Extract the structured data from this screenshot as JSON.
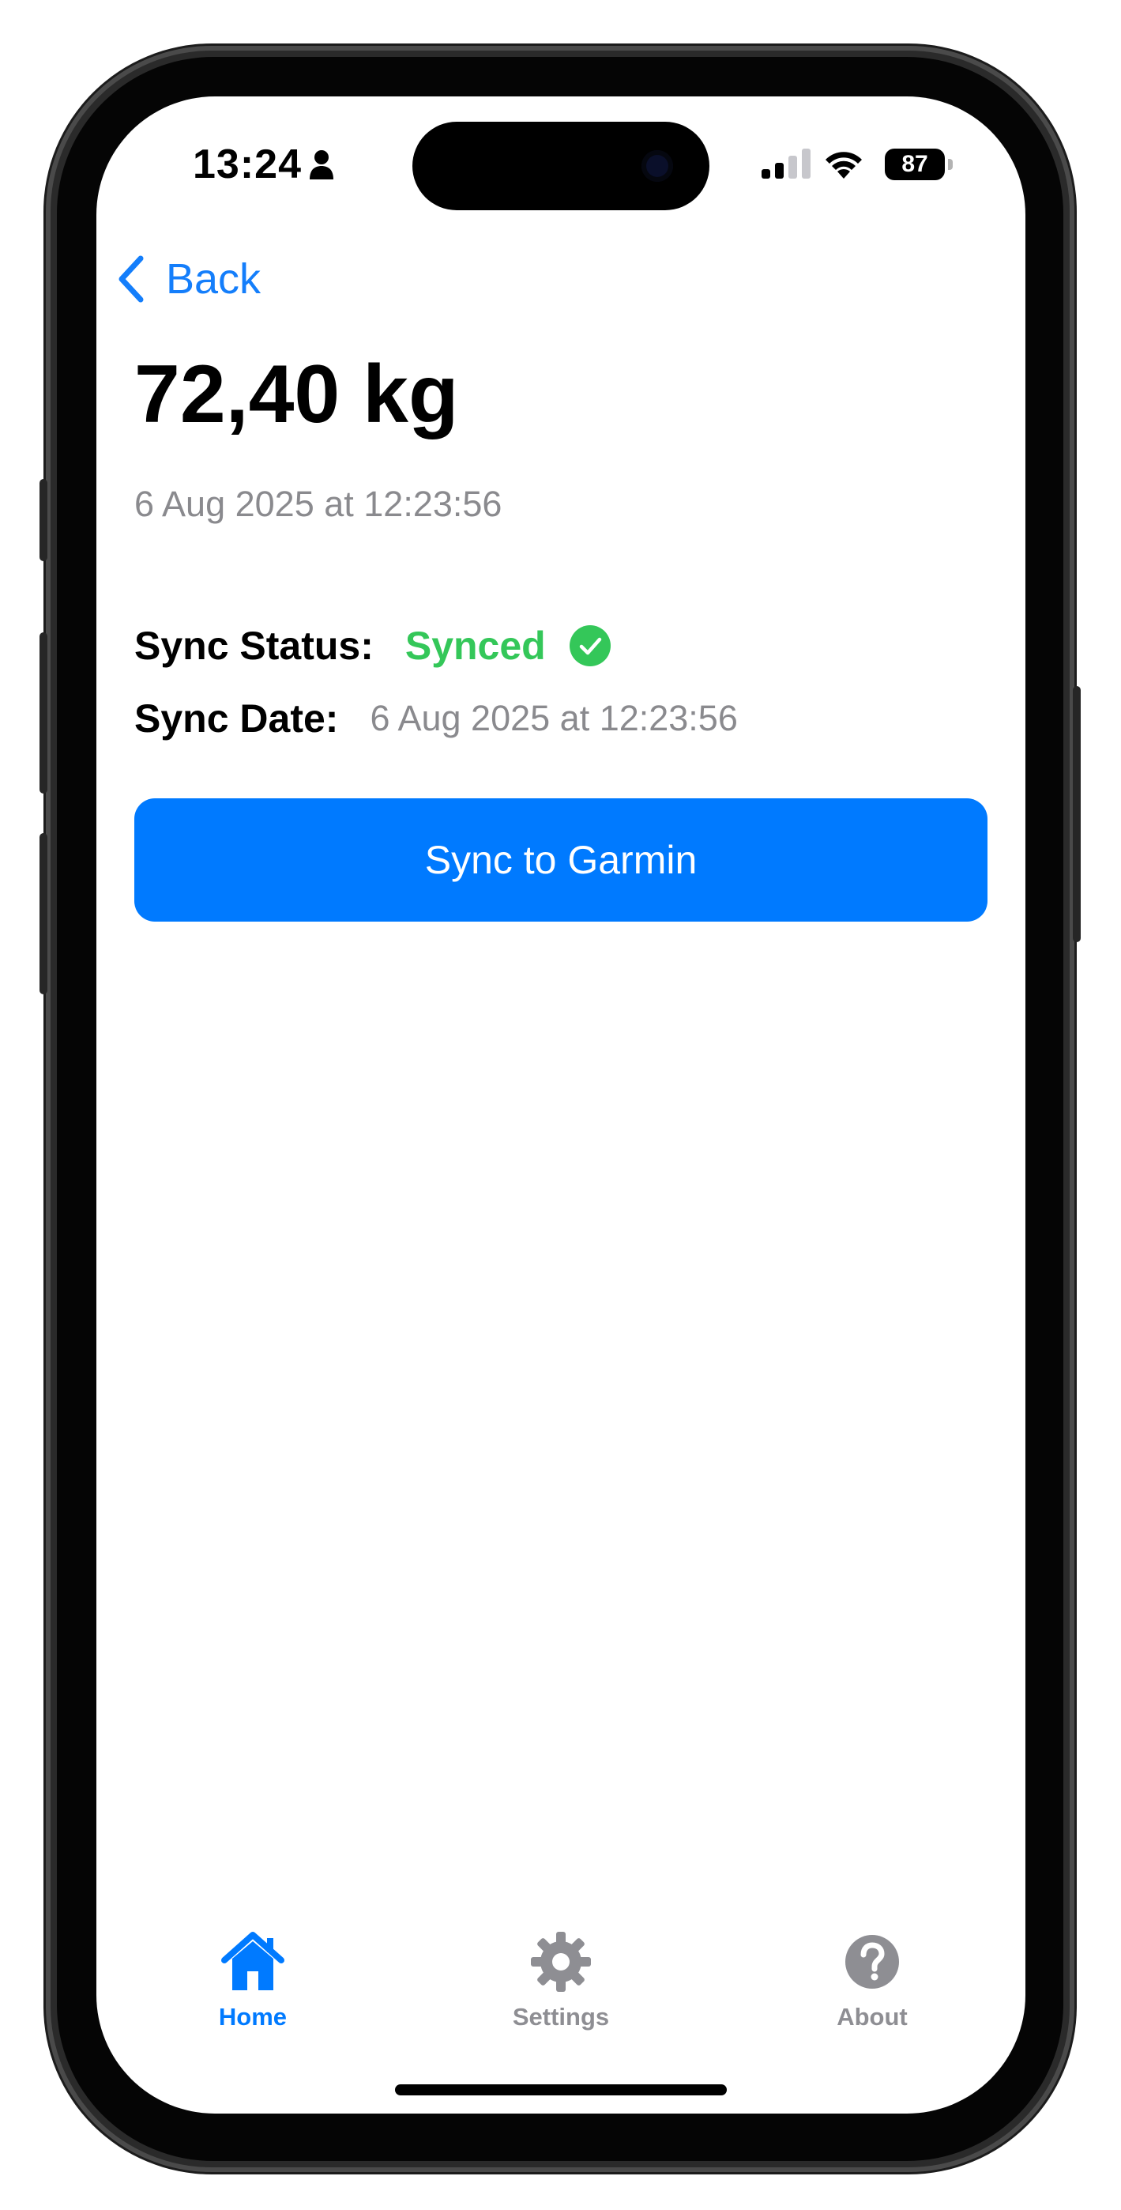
{
  "status_bar": {
    "time": "13:24",
    "battery_level": "87",
    "icons": [
      "person-icon",
      "signal-icon",
      "wifi-icon",
      "battery-icon"
    ]
  },
  "nav": {
    "back_label": "Back"
  },
  "entry": {
    "weight": "72,40 kg",
    "date": "6 Aug 2025 at 12:23:56"
  },
  "sync": {
    "status_label": "Sync Status:",
    "status_value": "Synced",
    "date_label": "Sync Date:",
    "date_value": "6 Aug 2025 at 12:23:56",
    "button_label": "Sync to Garmin"
  },
  "tab_bar": {
    "tabs": [
      {
        "label": "Home",
        "icon": "house-icon",
        "selected": true
      },
      {
        "label": "Settings",
        "icon": "gear-icon",
        "selected": false
      },
      {
        "label": "About",
        "icon": "question-icon",
        "selected": false
      }
    ]
  },
  "colors": {
    "accent": "#007aff",
    "success": "#34c759",
    "secondary_text": "#8a8a8e"
  }
}
